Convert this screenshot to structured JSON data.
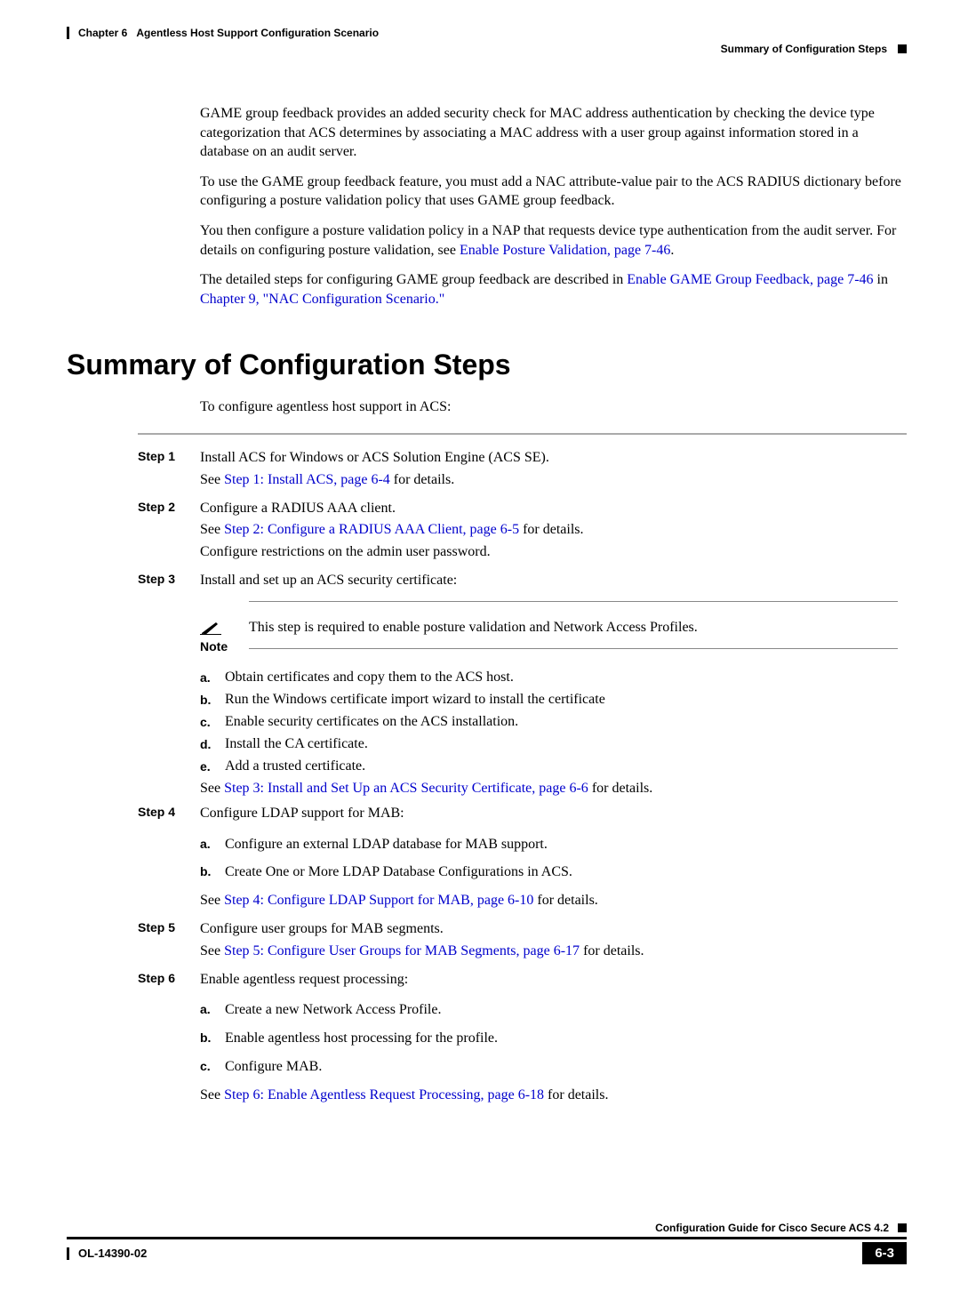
{
  "header": {
    "chapter_label": "Chapter 6",
    "chapter_title": "Agentless Host Support Configuration Scenario",
    "section_title": "Summary of Configuration Steps"
  },
  "intro": {
    "p1": "GAME group feedback provides an added security check for MAC address authentication by checking the device type categorization that ACS determines by associating a MAC address with a user group against information stored in a database on an audit server.",
    "p2": "To use the GAME group feedback feature, you must add a NAC attribute-value pair to the ACS RADIUS dictionary before configuring a posture validation policy that uses GAME group feedback.",
    "p3_a": "You then configure a posture validation policy in a NAP that requests device type authentication from the audit server. For details on configuring posture validation, see ",
    "p3_link": "Enable Posture Validation, page 7-46",
    "p3_b": ".",
    "p4_a": "The detailed steps for configuring GAME group feedback are described in ",
    "p4_link1": "Enable GAME Group Feedback, page 7-46",
    "p4_mid": " in ",
    "p4_link2": "Chapter 9, \"NAC Configuration Scenario.\""
  },
  "heading": "Summary of Configuration Steps",
  "lead": "To configure agentless host support in ACS:",
  "steps": {
    "s1_label": "Step 1",
    "s1_text": "Install ACS for Windows or ACS Solution Engine (ACS SE).",
    "s1_see_a": "See ",
    "s1_link": "Step 1: Install ACS, page 6-4",
    "s1_see_b": " for details.",
    "s2_label": "Step 2",
    "s2_text": "Configure a RADIUS AAA client.",
    "s2_see_a": "See ",
    "s2_link": "Step 2: Configure a RADIUS AAA Client, page 6-5",
    "s2_see_b": " for details.",
    "s2_extra": "Configure restrictions on the admin user password.",
    "s3_label": "Step 3",
    "s3_text": "Install and set up an ACS security certificate:",
    "note_label": "Note",
    "note_text": "This step is required to enable posture validation and Network Access Profiles.",
    "s3_a": "Obtain certificates and copy them to the ACS host.",
    "s3_b": "Run the Windows certificate import wizard to install the certificate",
    "s3_c": "Enable security certificates on the ACS installation.",
    "s3_d": "Install the CA certificate.",
    "s3_e": "Add a trusted certificate.",
    "s3_see_a": "See ",
    "s3_link": "Step 3: Install and Set Up an ACS Security Certificate, page 6-6",
    "s3_see_b": " for details.",
    "s4_label": "Step 4",
    "s4_text": "Configure LDAP support for MAB:",
    "s4_a": "Configure an external LDAP database for MAB support.",
    "s4_b": "Create One or More LDAP Database Configurations in ACS.",
    "s4_see_a": "See ",
    "s4_link": "Step 4: Configure LDAP Support for MAB, page 6-10",
    "s4_see_b": " for details.",
    "s5_label": "Step 5",
    "s5_text": "Configure user groups for MAB segments.",
    "s5_see_a": "See ",
    "s5_link": "Step 5: Configure User Groups for MAB Segments, page 6-17",
    "s5_see_b": " for details.",
    "s6_label": "Step 6",
    "s6_text": "Enable agentless request processing:",
    "s6_a": "Create a new Network Access Profile.",
    "s6_b": "Enable agentless host processing for the profile.",
    "s6_c": "Configure MAB.",
    "s6_see_a": "See ",
    "s6_link": "Step 6: Enable Agentless Request Processing, page 6-18",
    "s6_see_b": " for details."
  },
  "footer": {
    "guide": "Configuration Guide for Cisco Secure ACS 4.2",
    "docnum": "OL-14390-02",
    "pagenum": "6-3"
  },
  "sublabels": {
    "a": "a.",
    "b": "b.",
    "c": "c.",
    "d": "d.",
    "e": "e."
  }
}
